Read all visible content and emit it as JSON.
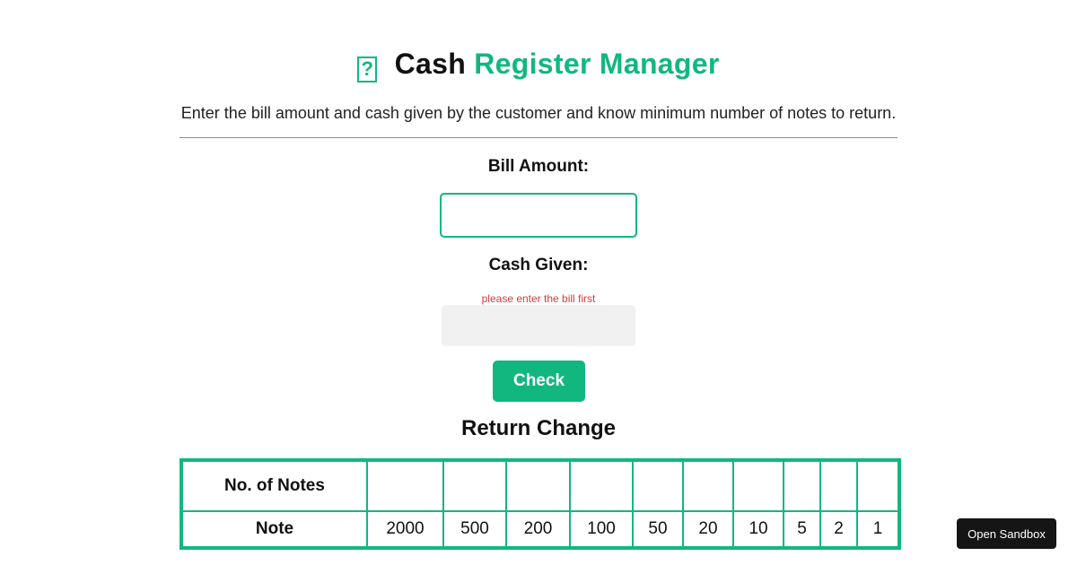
{
  "header": {
    "icon_glyph": "?",
    "title_part_a": "Cash",
    "title_part_b": "Register Manager",
    "subtitle": "Enter the bill amount and cash given by the customer and know minimum number of notes to return."
  },
  "form": {
    "bill_label": "Bill Amount:",
    "bill_value": "",
    "bill_placeholder": "",
    "cash_label": "Cash Given:",
    "cash_value": "",
    "cash_placeholder": "",
    "error_message": "please enter the bill first",
    "check_label": "Check"
  },
  "results": {
    "title": "Return Change",
    "row_headers": {
      "notes_count": "No. of Notes",
      "note": "Note"
    },
    "counts": [
      "",
      "",
      "",
      "",
      "",
      "",
      "",
      "",
      "",
      ""
    ],
    "notes": [
      "2000",
      "500",
      "200",
      "100",
      "50",
      "20",
      "10",
      "5",
      "2",
      "1"
    ]
  },
  "sandbox": {
    "label": "Open Sandbox"
  },
  "colors": {
    "accent": "#12b77f",
    "error": "#d83a3a",
    "disabled_input": "#f1f1f1",
    "dark_button": "#151515"
  },
  "icons": {
    "title_icon": "money-icon"
  }
}
